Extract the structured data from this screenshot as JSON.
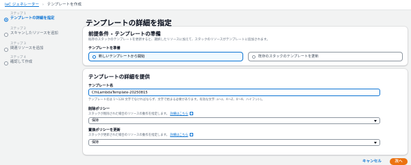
{
  "breadcrumb": {
    "items": [
      "IaC ジェネレーター",
      "テンプレートを作成"
    ]
  },
  "steps": [
    {
      "small": "ステップ 1",
      "title": "テンプレートの詳細を指定",
      "active": true
    },
    {
      "small": "ステップ 2",
      "title": "スキャンしたリソースを追加",
      "active": false
    },
    {
      "small": "ステップ 3",
      "title": "関連リソースを追加",
      "active": false
    },
    {
      "small": "ステップ 4",
      "title": "確認して作成",
      "active": false
    }
  ],
  "page_title": "テンプレートの詳細を指定",
  "prereq": {
    "title": "前提条件 - テンプレートの準備",
    "description": "既存のスタックのテンプレートを更新すると、選択したリソースに加えて、スタックのリソースがテンプレートに追加されます。",
    "label": "テンプレートを準備",
    "options": [
      "新しいテンプレートから開始",
      "既存のスタックのテンプレートを更新"
    ],
    "selected_index": 0
  },
  "details": {
    "title": "テンプレートの詳細を提供",
    "name_label": "テンプレート名",
    "name_value": "CfnLambdaTemplate-20250815",
    "name_help": "テンプレート名は 1～128 文字でなければならず、文字で始まる必要があります。有効な文字: a～z、A～Z、0～9、ハイフン(-)。",
    "deletion_label": "削除ポリシー",
    "deletion_help": "スタックが削除された場合のリソースの動作を指定します。",
    "deletion_link": "詳細はこちら",
    "deletion_value": "保持",
    "update_label": "置換ポリシーを更新",
    "update_help": "スタックが更新された場合のリソースの動作を指定します。",
    "update_link": "詳細はこちら",
    "update_value": "保持"
  },
  "footer": {
    "cancel_label": "キャンセル",
    "next_label": "次へ"
  },
  "colors": {
    "accent": "#0972d3",
    "primary_button": "#ec7211",
    "background": "#f2f3f3"
  }
}
